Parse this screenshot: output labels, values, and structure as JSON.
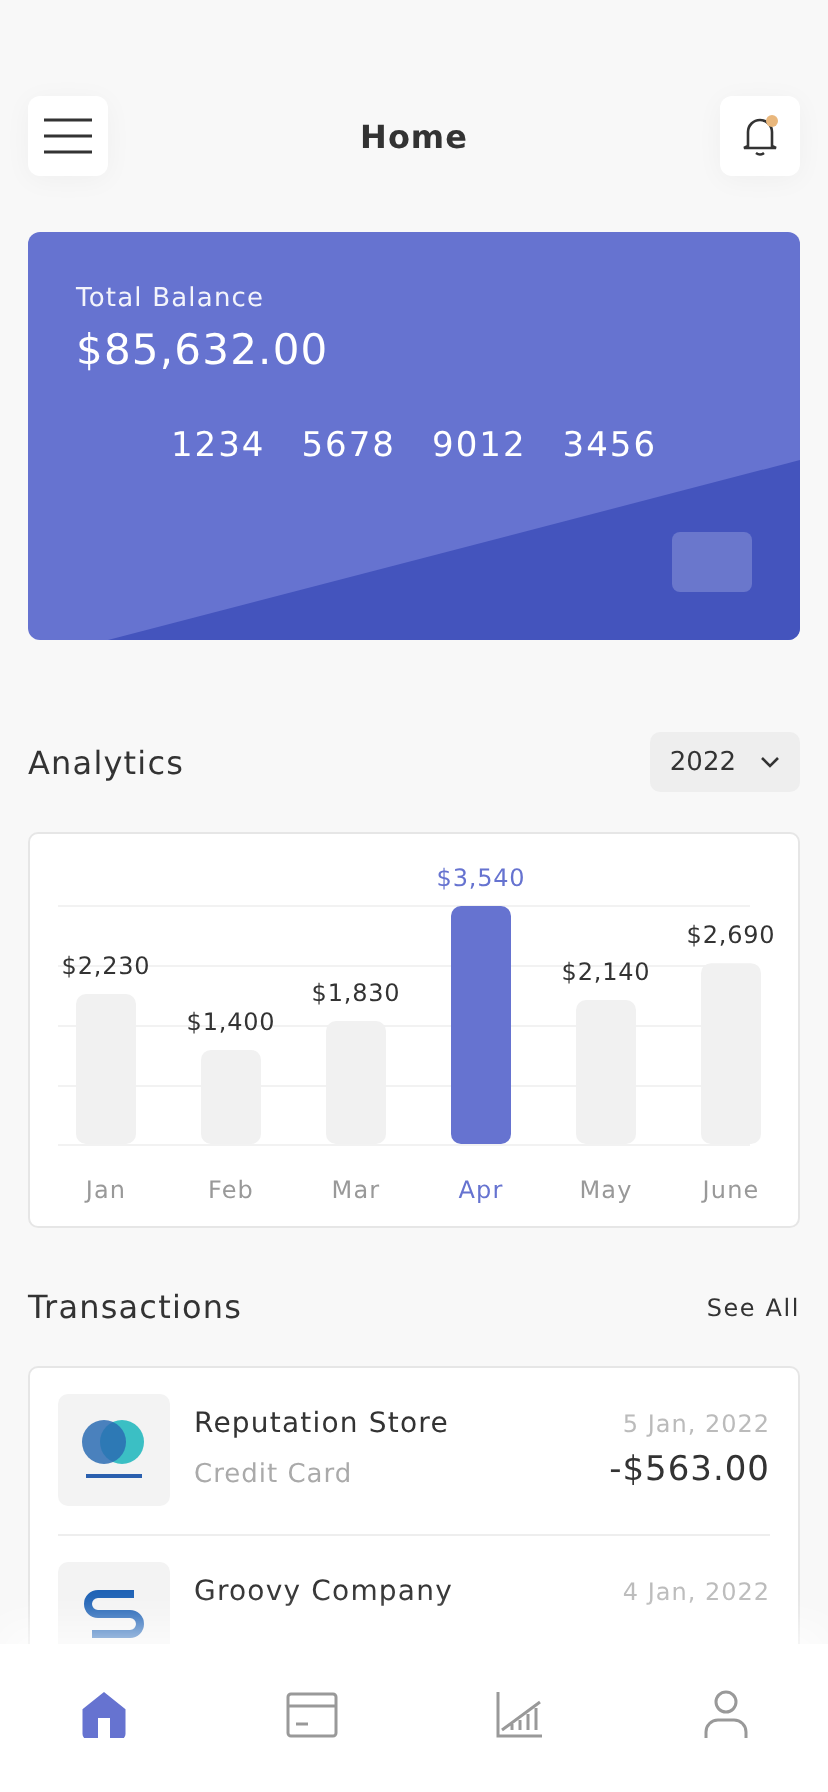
{
  "header": {
    "title": "Home",
    "notification_dot": true
  },
  "card": {
    "label": "Total Balance",
    "balance": "$85,632.00",
    "number_groups": [
      "1234",
      "5678",
      "9012",
      "3456"
    ]
  },
  "analytics": {
    "title": "Analytics",
    "year": "2022",
    "bars": [
      {
        "selected": false
      },
      {
        "selected": false
      },
      {
        "selected": false
      },
      {
        "selected": true
      },
      {
        "selected": false
      },
      {
        "selected": false
      }
    ],
    "chart_data": {
      "type": "bar",
      "categories": [
        "Jan",
        "Feb",
        "Mar",
        "Apr",
        "May",
        "June"
      ],
      "values": [
        2230,
        1400,
        1830,
        3540,
        2140,
        2690
      ],
      "value_labels": [
        "$2,230",
        "$1,400",
        "$1,830",
        "$3,540",
        "$2,140",
        "$2,690"
      ],
      "data_labels": true
    }
  },
  "transactions": {
    "title": "Transactions",
    "see_all": "See All",
    "items": [
      {
        "kind": "rings",
        "name": "Reputation Store",
        "method": "Credit Card",
        "date": "5 Jan, 2022",
        "amount": "-$563.00"
      },
      {
        "kind": "s",
        "name": "Groovy Company",
        "date": "4 Jan, 2022"
      }
    ]
  },
  "nav": [
    {
      "kind": "home",
      "selected": true
    },
    {
      "kind": "card",
      "selected": false
    },
    {
      "kind": "chart",
      "selected": false
    },
    {
      "kind": "profile",
      "selected": false
    }
  ]
}
